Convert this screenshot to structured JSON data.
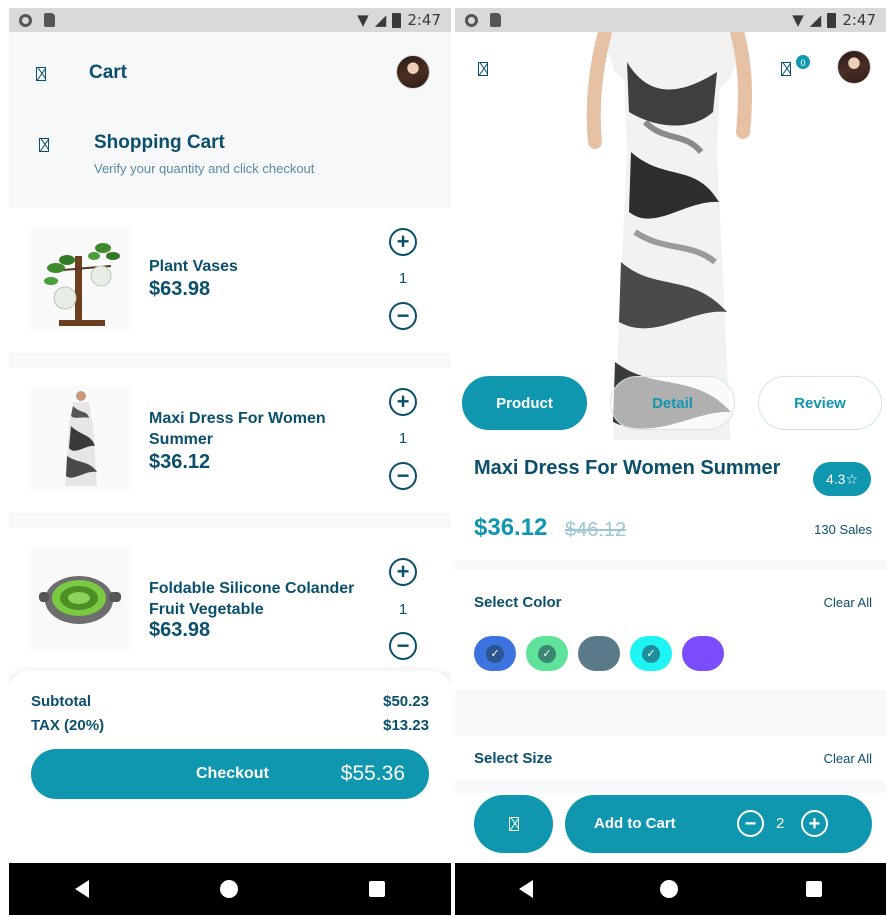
{
  "left": {
    "status_time": "2:47",
    "header": {
      "title": "Cart"
    },
    "section": {
      "title": "Shopping Cart",
      "subtitle": "Verify your quantity and click checkout"
    },
    "items": [
      {
        "name": "Plant Vases",
        "price": "$63.98",
        "qty": "1"
      },
      {
        "name": "Maxi Dress For Women Summer",
        "price": "$36.12",
        "qty": "1"
      },
      {
        "name": "Foldable Silicone Colander Fruit Vegetable",
        "price": "$63.98",
        "qty": "1"
      }
    ],
    "summary": {
      "subtotal_label": "Subtotal",
      "subtotal_value": "$50.23",
      "tax_label": "TAX (20%)",
      "tax_value": "$13.23",
      "checkout_label": "Checkout",
      "checkout_total": "$55.36"
    }
  },
  "right": {
    "status_time": "2:47",
    "cart_badge": "0",
    "tabs": [
      "Product",
      "Detail",
      "Review"
    ],
    "product": {
      "title": "Maxi Dress For Women Summer",
      "rating": "4.3☆",
      "price": "$36.12",
      "old_price": "$46.12",
      "sales": "130 Sales"
    },
    "colors": {
      "label": "Select Color",
      "clear_label": "Clear All",
      "swatches": [
        {
          "color": "#3d73de",
          "selected": true
        },
        {
          "color": "#5fe39a",
          "selected": true
        },
        {
          "color": "#5a7a8a",
          "selected": false
        },
        {
          "color": "#1ff4f4",
          "selected": true
        },
        {
          "color": "#7c4dff",
          "selected": false
        }
      ]
    },
    "size": {
      "label": "Select Size",
      "clear_label": "Clear All"
    },
    "add_to_cart": {
      "label": "Add to Cart",
      "qty": "2"
    }
  },
  "theme": {
    "accent": "#0f97b0",
    "text": "#0b4f6c"
  }
}
